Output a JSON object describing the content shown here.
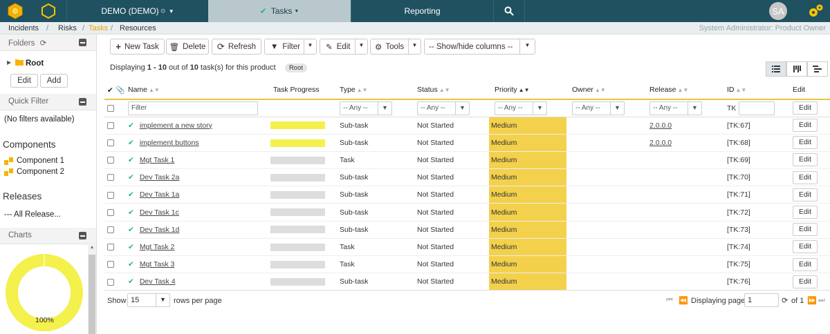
{
  "topbar": {
    "project": "DEMO (DEMO)",
    "tasks": "Tasks",
    "reporting": "Reporting",
    "avatar": "SA"
  },
  "breadcrumb": {
    "items": [
      "Incidents",
      "Risks",
      "Tasks",
      "Resources"
    ],
    "user": "System Administrator: Product Owner"
  },
  "sidebar": {
    "folders_title": "Folders",
    "root": "Root",
    "edit": "Edit",
    "add": "Add",
    "quick_filter_title": "Quick Filter",
    "no_filters": "(No filters available)",
    "components_title": "Components",
    "components": [
      "Component 1",
      "Component 2"
    ],
    "releases_title": "Releases",
    "releases_value": "--- All Release...",
    "charts_title": "Charts",
    "chart_label": "100%"
  },
  "toolbar": {
    "new_task": "New Task",
    "delete": "Delete",
    "refresh": "Refresh",
    "filter": "Filter",
    "edit": "Edit",
    "tools": "Tools",
    "columns": "-- Show/hide columns --"
  },
  "display": {
    "prefix": "Displaying",
    "range": "1 - 10",
    "mid": "out of",
    "total": "10",
    "suffix": "task(s) for this product",
    "tag": "Root"
  },
  "columns": {
    "name": "Name",
    "progress": "Task Progress",
    "type": "Type",
    "status": "Status",
    "priority": "Priority",
    "owner": "Owner",
    "release": "Release",
    "id": "ID",
    "edit": "Edit"
  },
  "filters": {
    "name_placeholder": "Filter",
    "any": "-- Any --",
    "id_prefix": "TK"
  },
  "rows": [
    {
      "name": "implement a new story",
      "type": "Sub-task",
      "status": "Not Started",
      "priority": "Medium",
      "release": "2.0.0.0",
      "id": "[TK:67]",
      "progress": "yellow"
    },
    {
      "name": "implement buttons",
      "type": "Sub-task",
      "status": "Not Started",
      "priority": "Medium",
      "release": "2.0.0.0",
      "id": "[TK:68]",
      "progress": "yellow"
    },
    {
      "name": "Mgt Task 1",
      "type": "Task",
      "status": "Not Started",
      "priority": "Medium",
      "release": "",
      "id": "[TK:69]",
      "progress": "grey"
    },
    {
      "name": "Dev Task 2a",
      "type": "Sub-task",
      "status": "Not Started",
      "priority": "Medium",
      "release": "",
      "id": "[TK:70]",
      "progress": "grey"
    },
    {
      "name": "Dev Task 1a",
      "type": "Sub-task",
      "status": "Not Started",
      "priority": "Medium",
      "release": "",
      "id": "[TK:71]",
      "progress": "grey"
    },
    {
      "name": "Dev Task 1c",
      "type": "Sub-task",
      "status": "Not Started",
      "priority": "Medium",
      "release": "",
      "id": "[TK:72]",
      "progress": "grey"
    },
    {
      "name": "Dev Task 1d",
      "type": "Sub-task",
      "status": "Not Started",
      "priority": "Medium",
      "release": "",
      "id": "[TK:73]",
      "progress": "grey"
    },
    {
      "name": "Mgt Task 2",
      "type": "Task",
      "status": "Not Started",
      "priority": "Medium",
      "release": "",
      "id": "[TK:74]",
      "progress": "grey"
    },
    {
      "name": "Mgt Task 3",
      "type": "Task",
      "status": "Not Started",
      "priority": "Medium",
      "release": "",
      "id": "[TK:75]",
      "progress": "grey"
    },
    {
      "name": "Dev Task 4",
      "type": "Sub-task",
      "status": "Not Started",
      "priority": "Medium",
      "release": "",
      "id": "[TK:76]",
      "progress": "grey"
    }
  ],
  "row_edit_label": "Edit",
  "footer": {
    "show": "Show",
    "rows_value": "15",
    "rows_per_page": "rows per page",
    "displaying_page": "Displaying page",
    "page": "1",
    "of": "of 1"
  },
  "colors": {
    "topbar": "#1f5160",
    "priority": "#f3d14c",
    "progress_yellow": "#f4f04c",
    "accent": "#e8a400",
    "check": "#2bb673"
  }
}
